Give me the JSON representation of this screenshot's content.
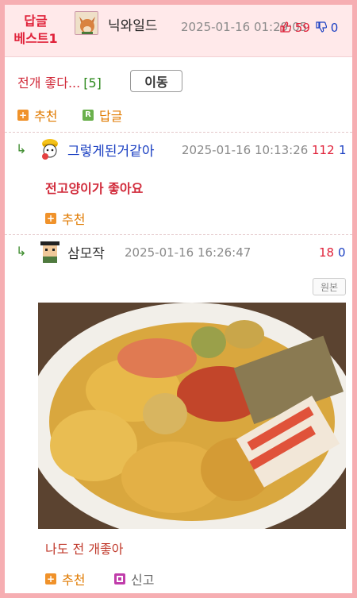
{
  "best_comment": {
    "badge_line1": "답글",
    "badge_line2": "베스트1",
    "nickname": "닉와일드",
    "date": "2025-01-16 01:29:05",
    "upvotes": "59",
    "downvotes": "0"
  },
  "post": {
    "title": "전개 좋다...",
    "count": "[5]",
    "move_label": "이동",
    "recommend_label": "추천",
    "reply_label": "답글",
    "reply_icon_letter": "R"
  },
  "replies": [
    {
      "nickname": "그렇게된거같아",
      "nickname_color": "#1a3fc2",
      "date": "2025-01-16 10:13:26",
      "upvotes": "112",
      "downvotes": "1",
      "text": "전고양이가 좋아요",
      "recommend_label": "추천"
    },
    {
      "nickname": "삼모작",
      "nickname_color": "#333333",
      "date": "2025-01-16 16:26:47",
      "upvotes": "18",
      "downvotes": "0",
      "original_label": "원본",
      "caption": "나도 전 개좋아",
      "recommend_label": "추천",
      "report_label": "신고"
    }
  ],
  "colors": {
    "frame": "#f6aeb2",
    "header_bg": "#ffe9ea",
    "accent_red": "#e0223a",
    "down_blue": "#1a3fc2",
    "recommend_orange": "#e07a00"
  },
  "icons": {
    "reply_arrow": "↳",
    "thumb_up": "thumb-up-icon",
    "thumb_down": "thumb-down-icon"
  }
}
